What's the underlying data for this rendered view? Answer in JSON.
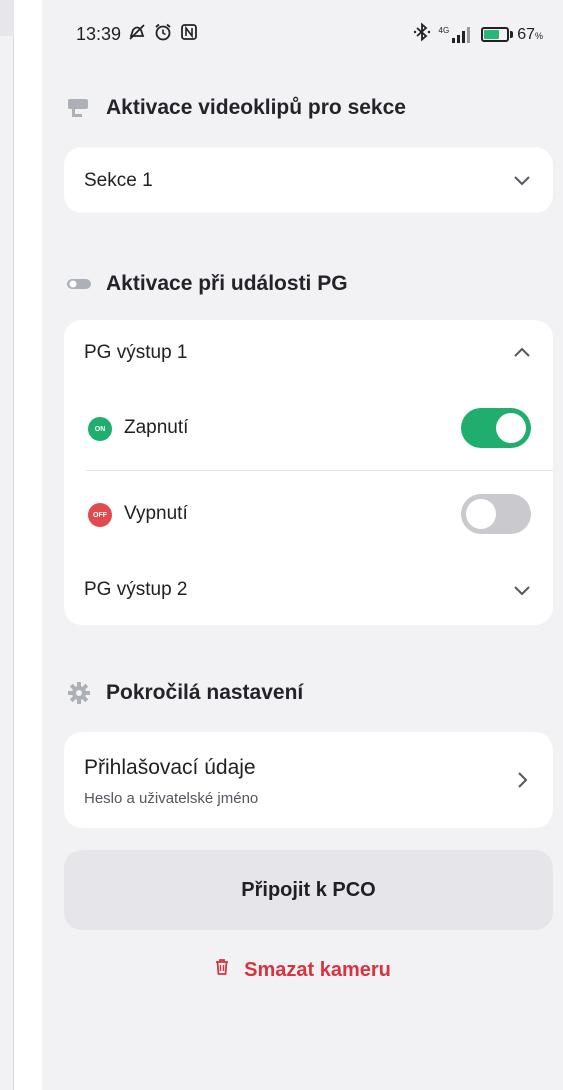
{
  "status_bar": {
    "time": "13:39",
    "network": "4G",
    "battery_level": 67,
    "battery_text": "67",
    "battery_unit": "%"
  },
  "video_section": {
    "title": "Aktivace videoklipů pro sekce",
    "selected": "Sekce 1"
  },
  "pg_section": {
    "title": "Aktivace při události PG",
    "outputs": [
      {
        "label": "PG výstup 1",
        "expanded": true
      },
      {
        "label": "PG výstup 2",
        "expanded": false
      }
    ],
    "events": [
      {
        "badge": "ON",
        "label": "Zapnutí",
        "enabled": true
      },
      {
        "badge": "OFF",
        "label": "Vypnutí",
        "enabled": false
      }
    ]
  },
  "advanced_section": {
    "title": "Pokročilá nastavení",
    "credentials_title": "Přihlašovací údaje",
    "credentials_subtitle": "Heslo a uživatelské jméno"
  },
  "actions": {
    "connect_label": "Připojit k PCO",
    "delete_label": "Smazat kameru"
  },
  "colors": {
    "accent_green": "#1fae6d",
    "danger_red": "#d9333f",
    "background": "#f2f2f5"
  }
}
